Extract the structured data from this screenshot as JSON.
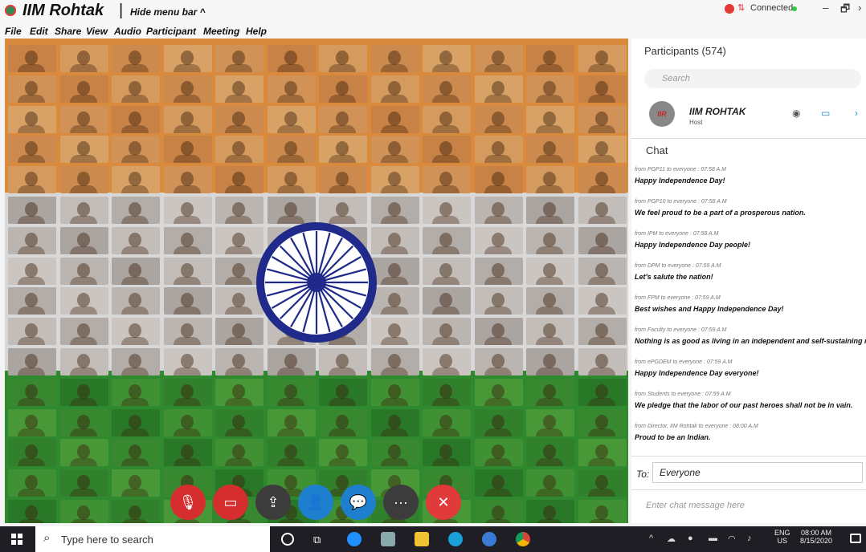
{
  "window": {
    "title": "IIM Rohtak",
    "separator": "|",
    "hide_menu_label": "Hide menu bar ^",
    "status": "Connected",
    "status_icon": "signal-icon",
    "minimize_glyph": "–",
    "restore_glyph": "🗗",
    "more_glyph": "›"
  },
  "menu": [
    "File",
    "Edit",
    "Share",
    "View",
    "Audio",
    "Participant",
    "Meeting",
    "Help"
  ],
  "gallery": {
    "flag_colors": {
      "saffron": "#d98a3d",
      "white": "#d8d8d8",
      "green": "#2f8a2f",
      "chakra": "#1f2a8a"
    }
  },
  "controls": [
    {
      "name": "mute-mic-button",
      "icon": "mic-off-icon",
      "glyph": "🎙",
      "color": "#d62e2e"
    },
    {
      "name": "stop-video-button",
      "icon": "video-off-icon",
      "glyph": "▭",
      "color": "#d62e2e"
    },
    {
      "name": "share-screen-button",
      "icon": "share-icon",
      "glyph": "⇪",
      "color": "#3c3c3c"
    },
    {
      "name": "participants-button",
      "icon": "participants-icon",
      "glyph": "👤",
      "color": "#1f7fcf"
    },
    {
      "name": "chat-button",
      "icon": "chat-icon",
      "glyph": "💬",
      "color": "#1f7fcf"
    },
    {
      "name": "more-button",
      "icon": "more-icon",
      "glyph": "···",
      "color": "#3c3c3c"
    },
    {
      "name": "leave-button",
      "icon": "close-icon",
      "glyph": "✕",
      "color": "#e03a3a"
    }
  ],
  "participants": {
    "title": "Participants (574)",
    "search_placeholder": "Search",
    "host": {
      "initials": "IIR",
      "name": "IIM ROHTAK",
      "role": "Host"
    }
  },
  "chat": {
    "title": "Chat",
    "messages": [
      {
        "meta": "from PGP11 to everyone :   07:58 A.M",
        "text": "Happy Independence Day!"
      },
      {
        "meta": "from PGP10 to everyone :   07:58 A.M",
        "text": "We feel proud to be a part of a prosperous nation."
      },
      {
        "meta": "from IPM to everyone :   07:58 A.M",
        "text": "Happy Independence Day people!"
      },
      {
        "meta": "from DPM to everyone :   07:59 A.M",
        "text": "Let's salute the nation!"
      },
      {
        "meta": "from FPM to everyone :   07:59 A.M",
        "text": "Best wishes and Happy Independence Day!"
      },
      {
        "meta": "from Faculty to everyone :   07:59 A.M",
        "text": "Nothing is as good as living in an independent and self-sustaining nation."
      },
      {
        "meta": "from ePGDEM to everyone :   07:59 A.M",
        "text": "Happy Independence Day everyone!"
      },
      {
        "meta": "from Students to everyone :   07:59 A.M",
        "text": "We pledge that the labor of our past heroes shall not be in vain."
      },
      {
        "meta": "from Director, IIM Rohtak to everyone :   08:00 A.M",
        "text": "Proud to be an Indian."
      }
    ],
    "to_label": "To:",
    "to_value": "Everyone",
    "input_placeholder": "Enter chat message here"
  },
  "taskbar": {
    "search_placeholder": "Type here to search",
    "language": "ENG",
    "region": "US",
    "time": "08:00 AM",
    "date": "8/15/2020"
  }
}
